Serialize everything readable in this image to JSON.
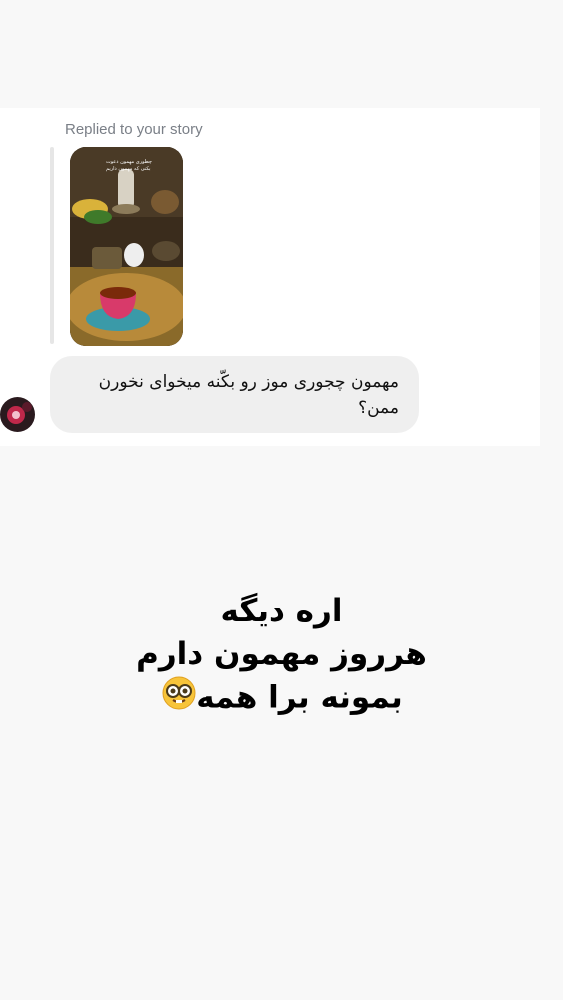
{
  "story_reply": {
    "replied_label": "Replied to your story",
    "thumbnail_caption_line1": "چطوری مهمون دعوت",
    "thumbnail_caption_line2": "بکنی که مهمون داریم"
  },
  "message": {
    "text": "مهمون چجوری موز رو بکّنه میخوای نخورن ممن؟"
  },
  "caption": {
    "line1": "اره دیگه",
    "line2": "هرروز مهمون دارم",
    "line3": "بمونه برا همه",
    "emoji_icon": "nerd-face-emoji"
  },
  "colors": {
    "page_bg": "#f8f8f8",
    "card_bg": "#ffffff",
    "bubble_bg": "#efefef",
    "label_gray": "#7a7f87"
  }
}
